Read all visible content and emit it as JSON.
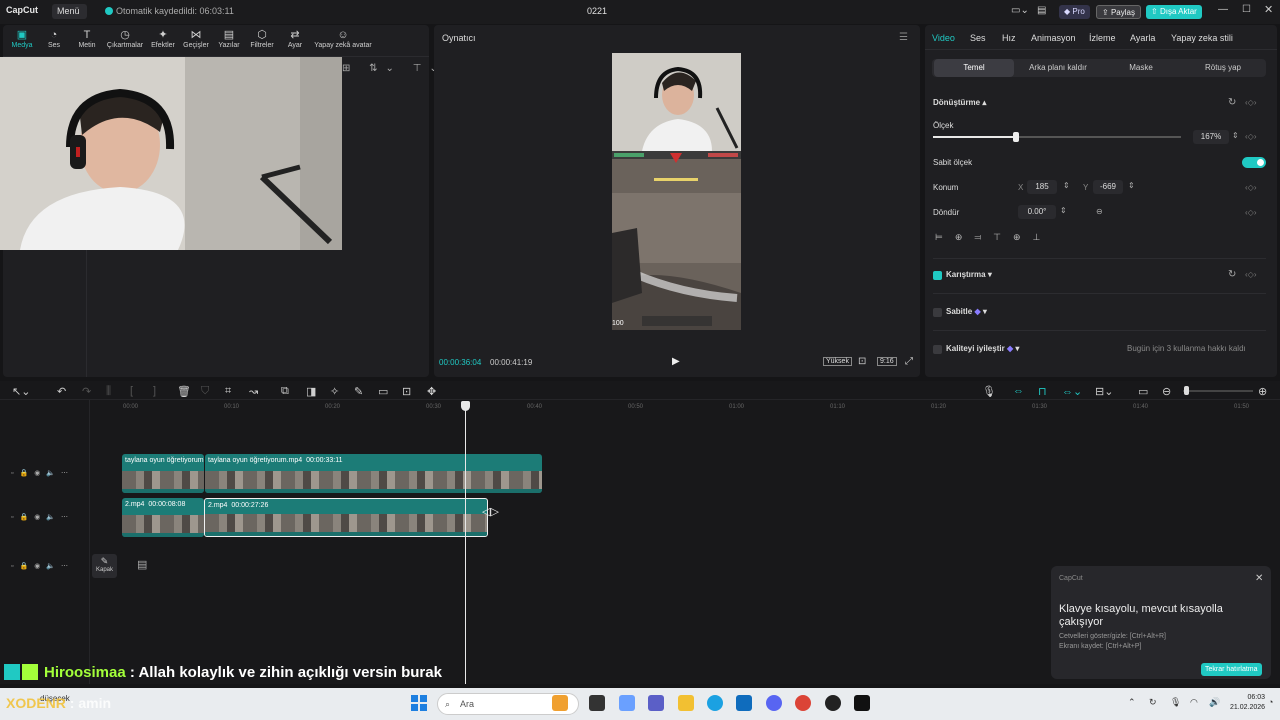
{
  "titlebar": {
    "logo": "CapCut",
    "menu_label": "Menü",
    "autosave": "Otomatik kaydedildi: 06:03:11",
    "project_title": "0221",
    "pro_label": "Pro",
    "share_label": "Paylaş",
    "export_label": "Dışa Aktar"
  },
  "toolbar": {
    "tabs": [
      {
        "label": "Medya",
        "icon": "media-icon"
      },
      {
        "label": "Ses",
        "icon": "audio-icon"
      },
      {
        "label": "Metin",
        "icon": "text-icon"
      },
      {
        "label": "Çıkartmalar",
        "icon": "sticker-icon"
      },
      {
        "label": "Efektler",
        "icon": "effects-icon"
      },
      {
        "label": "Geçişler",
        "icon": "transitions-icon"
      },
      {
        "label": "Yazılar",
        "icon": "captions-icon"
      },
      {
        "label": "Filtreler",
        "icon": "filters-icon"
      },
      {
        "label": "Ayar",
        "icon": "adjust-icon"
      },
      {
        "label": "Yapay zekâ avatar",
        "icon": "ai-avatar-icon"
      }
    ]
  },
  "player": {
    "title": "Oynatıcı",
    "current_time": "00:00:36:04",
    "total_time": "00:00:41:19",
    "quality": "Yüksek",
    "ratio": "9:16",
    "game_score": "100"
  },
  "properties": {
    "tabs": [
      "Video",
      "Ses",
      "Hız",
      "Animasyon",
      "İzleme",
      "Ayarla",
      "Yapay zeka stili"
    ],
    "subtabs": [
      "Temel",
      "Arka planı kaldır",
      "Maske",
      "Rötuş yap"
    ],
    "transform_label": "Dönüştürme",
    "scale_label": "Ölçek",
    "scale_value": "167%",
    "uniform_scale_label": "Sabit ölçek",
    "position_label": "Konum",
    "pos_x_label": "X",
    "pos_x": "185",
    "pos_y_label": "Y",
    "pos_y": "-669",
    "rotate_label": "Döndür",
    "rotate_value": "0.00°",
    "blend_label": "Karıştırma",
    "stabilize_label": "Sabitle",
    "enhance_label": "Kaliteyi iyileştir",
    "enhance_note": "Bugün için 3 kullanma hakkı kaldı"
  },
  "timeline": {
    "ruler": [
      "00:00",
      "00:10",
      "00:20",
      "00:30",
      "00:40",
      "00:50",
      "01:00",
      "01:10",
      "01:20",
      "01:30",
      "01:40",
      "01:50"
    ],
    "track1": {
      "clip1": "taylana oyun öğretiyorum",
      "clip2": "taylana oyun öğretiyorum.mp4",
      "clip2_dur": "00:00:33:11"
    },
    "track2": {
      "clip1": "2.mp4",
      "clip1_dur": "00:00:08:08",
      "clip2": "2.mp4",
      "clip2_dur": "00:00:27:26"
    },
    "cover_label": "Kapak"
  },
  "notification": {
    "app": "CapCut",
    "title": "Klavye kısayolu, mevcut kısayolla çakışıyor",
    "line1": "Cetvelleri göster/gizle: [Ctrl+Alt+R]",
    "line2": "Ekranı kaydet: [Ctrl+Alt+P]",
    "button": "Tekrar hatırlatma"
  },
  "chat": {
    "user": "Hiroosimaa",
    "message": " : Allah kolaylık ve zihin açıklığı versin burak"
  },
  "taskbar": {
    "watermark_a": "XODENR",
    "watermark_b": ": amin",
    "weather": "düşecek",
    "search_placeholder": "Ara",
    "time": "06:03",
    "date": "21.02.2026"
  }
}
